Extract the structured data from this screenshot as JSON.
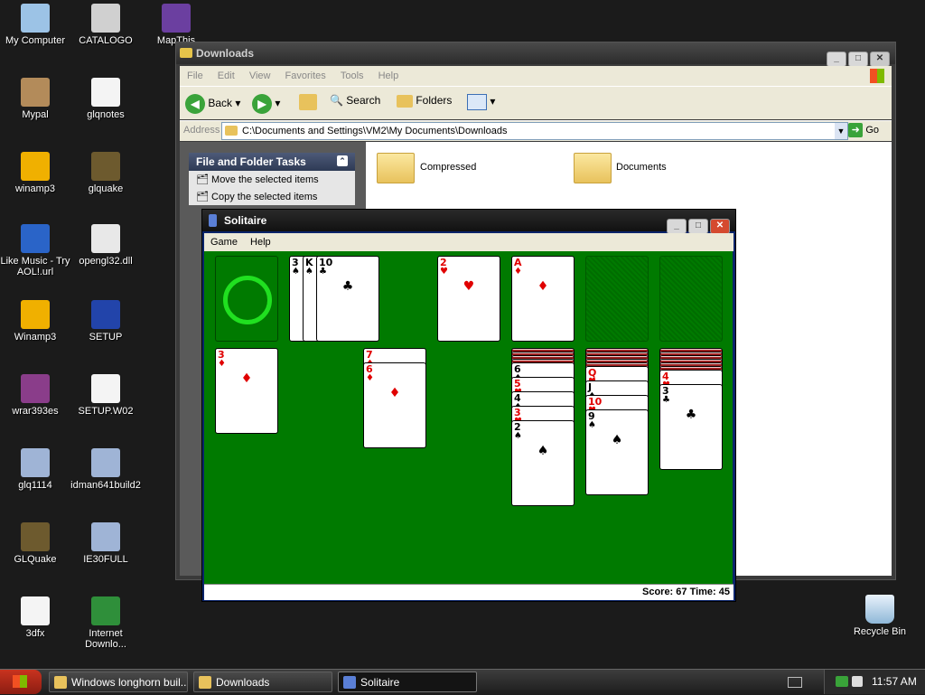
{
  "desktop": {
    "icons": [
      {
        "label": "My Computer",
        "icon": "computer-icon"
      },
      {
        "label": "CATALOGO",
        "icon": "cd-icon"
      },
      {
        "label": "MapThis",
        "icon": "map-icon"
      },
      {
        "label": "Mypal",
        "icon": "mypal-icon"
      },
      {
        "label": "glqnotes",
        "icon": "document-icon"
      },
      {
        "label": "winamp3",
        "icon": "winamp-icon"
      },
      {
        "label": "glquake",
        "icon": "quake-icon"
      },
      {
        "label": "Like Music - Try AOL!.url",
        "icon": "music-shortcut-icon"
      },
      {
        "label": "opengl32.dll",
        "icon": "dll-icon"
      },
      {
        "label": "Winamp3",
        "icon": "winamp-icon"
      },
      {
        "label": "SETUP",
        "icon": "setup-icon"
      },
      {
        "label": "wrar393es",
        "icon": "winrar-icon"
      },
      {
        "label": "SETUP.W02",
        "icon": "file-icon"
      },
      {
        "label": "glq1114",
        "icon": "installer-icon"
      },
      {
        "label": "idman641build2",
        "icon": "installer-icon"
      },
      {
        "label": "GLQuake",
        "icon": "quake-icon"
      },
      {
        "label": "IE30FULL",
        "icon": "installer-icon"
      },
      {
        "label": "3dfx",
        "icon": "document-icon"
      },
      {
        "label": "Internet Downlo...",
        "icon": "ie-download-icon"
      }
    ],
    "recycle_bin": "Recycle Bin"
  },
  "explorer": {
    "title": "Downloads",
    "menu": [
      "File",
      "Edit",
      "View",
      "Favorites",
      "Tools",
      "Help"
    ],
    "toolbar": {
      "back": "Back",
      "search": "Search",
      "folders": "Folders"
    },
    "address_label": "Address",
    "address_value": "C:\\Documents and Settings\\VM2\\My Documents\\Downloads",
    "go_label": "Go",
    "tasks_title": "File and Folder Tasks",
    "tasks": [
      "Move the selected items",
      "Copy the selected items"
    ],
    "folders": [
      "Compressed",
      "Documents"
    ]
  },
  "solitaire": {
    "title": "Solitaire",
    "menu": [
      "Game",
      "Help"
    ],
    "score_label": "Score: 67 Time: 45",
    "waste": [
      {
        "rank": "3",
        "suit": "♠",
        "color": "#000000"
      },
      {
        "rank": "K",
        "suit": "♠",
        "color": "#000000"
      },
      {
        "rank": "10",
        "suit": "♣",
        "color": "#000000"
      }
    ],
    "foundations": [
      {
        "rank": "2",
        "suit": "♥",
        "color": "#e00000"
      },
      {
        "rank": "A",
        "suit": "♦",
        "color": "#e00000"
      },
      {
        "rank": "",
        "suit": "",
        "color": ""
      },
      {
        "rank": "",
        "suit": "",
        "color": ""
      }
    ],
    "tableau": [
      {
        "face_down": 0,
        "cards": [
          {
            "rank": "3",
            "suit": "♦",
            "color": "#e00000"
          }
        ]
      },
      {
        "face_down": 0,
        "cards": []
      },
      {
        "face_down": 0,
        "cards": [
          {
            "rank": "7",
            "suit": "♦",
            "color": "#e00000"
          },
          {
            "rank": "6",
            "suit": "♦",
            "color": "#e00000"
          }
        ]
      },
      {
        "face_down": 0,
        "cards": []
      },
      {
        "face_down": 4,
        "cards": [
          {
            "rank": "6",
            "suit": "♠",
            "color": "#000000"
          },
          {
            "rank": "5",
            "suit": "♥",
            "color": "#e00000"
          },
          {
            "rank": "4",
            "suit": "♠",
            "color": "#000000"
          },
          {
            "rank": "3",
            "suit": "♥",
            "color": "#e00000"
          },
          {
            "rank": "2",
            "suit": "♠",
            "color": "#000000"
          }
        ]
      },
      {
        "face_down": 5,
        "cards": [
          {
            "rank": "Q",
            "suit": "♥",
            "color": "#e00000"
          },
          {
            "rank": "J",
            "suit": "♠",
            "color": "#000000"
          },
          {
            "rank": "10",
            "suit": "♥",
            "color": "#e00000"
          },
          {
            "rank": "9",
            "suit": "♠",
            "color": "#000000"
          }
        ]
      },
      {
        "face_down": 6,
        "cards": [
          {
            "rank": "4",
            "suit": "♥",
            "color": "#e00000"
          },
          {
            "rank": "3",
            "suit": "♣",
            "color": "#000000"
          }
        ]
      }
    ]
  },
  "taskbar": {
    "start": "start",
    "buttons": [
      "Windows longhorn buil...",
      "Downloads",
      "Solitaire"
    ],
    "clock": "11:57 AM"
  }
}
